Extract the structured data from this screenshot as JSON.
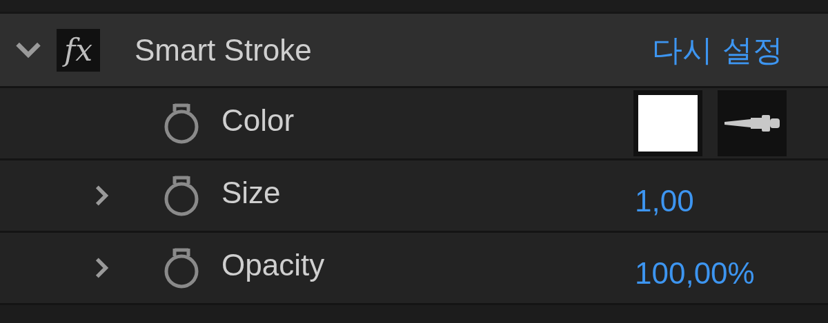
{
  "effect": {
    "expanded": true,
    "badge": "fx",
    "name": "Smart Stroke",
    "reset": "다시 설정"
  },
  "properties": [
    {
      "kind": "color",
      "name": "Color",
      "color": "#ffffff"
    },
    {
      "kind": "value",
      "name": "Size",
      "expanded": false,
      "value": "1,00"
    },
    {
      "kind": "value",
      "name": "Opacity",
      "expanded": false,
      "value": "100,00%"
    }
  ]
}
